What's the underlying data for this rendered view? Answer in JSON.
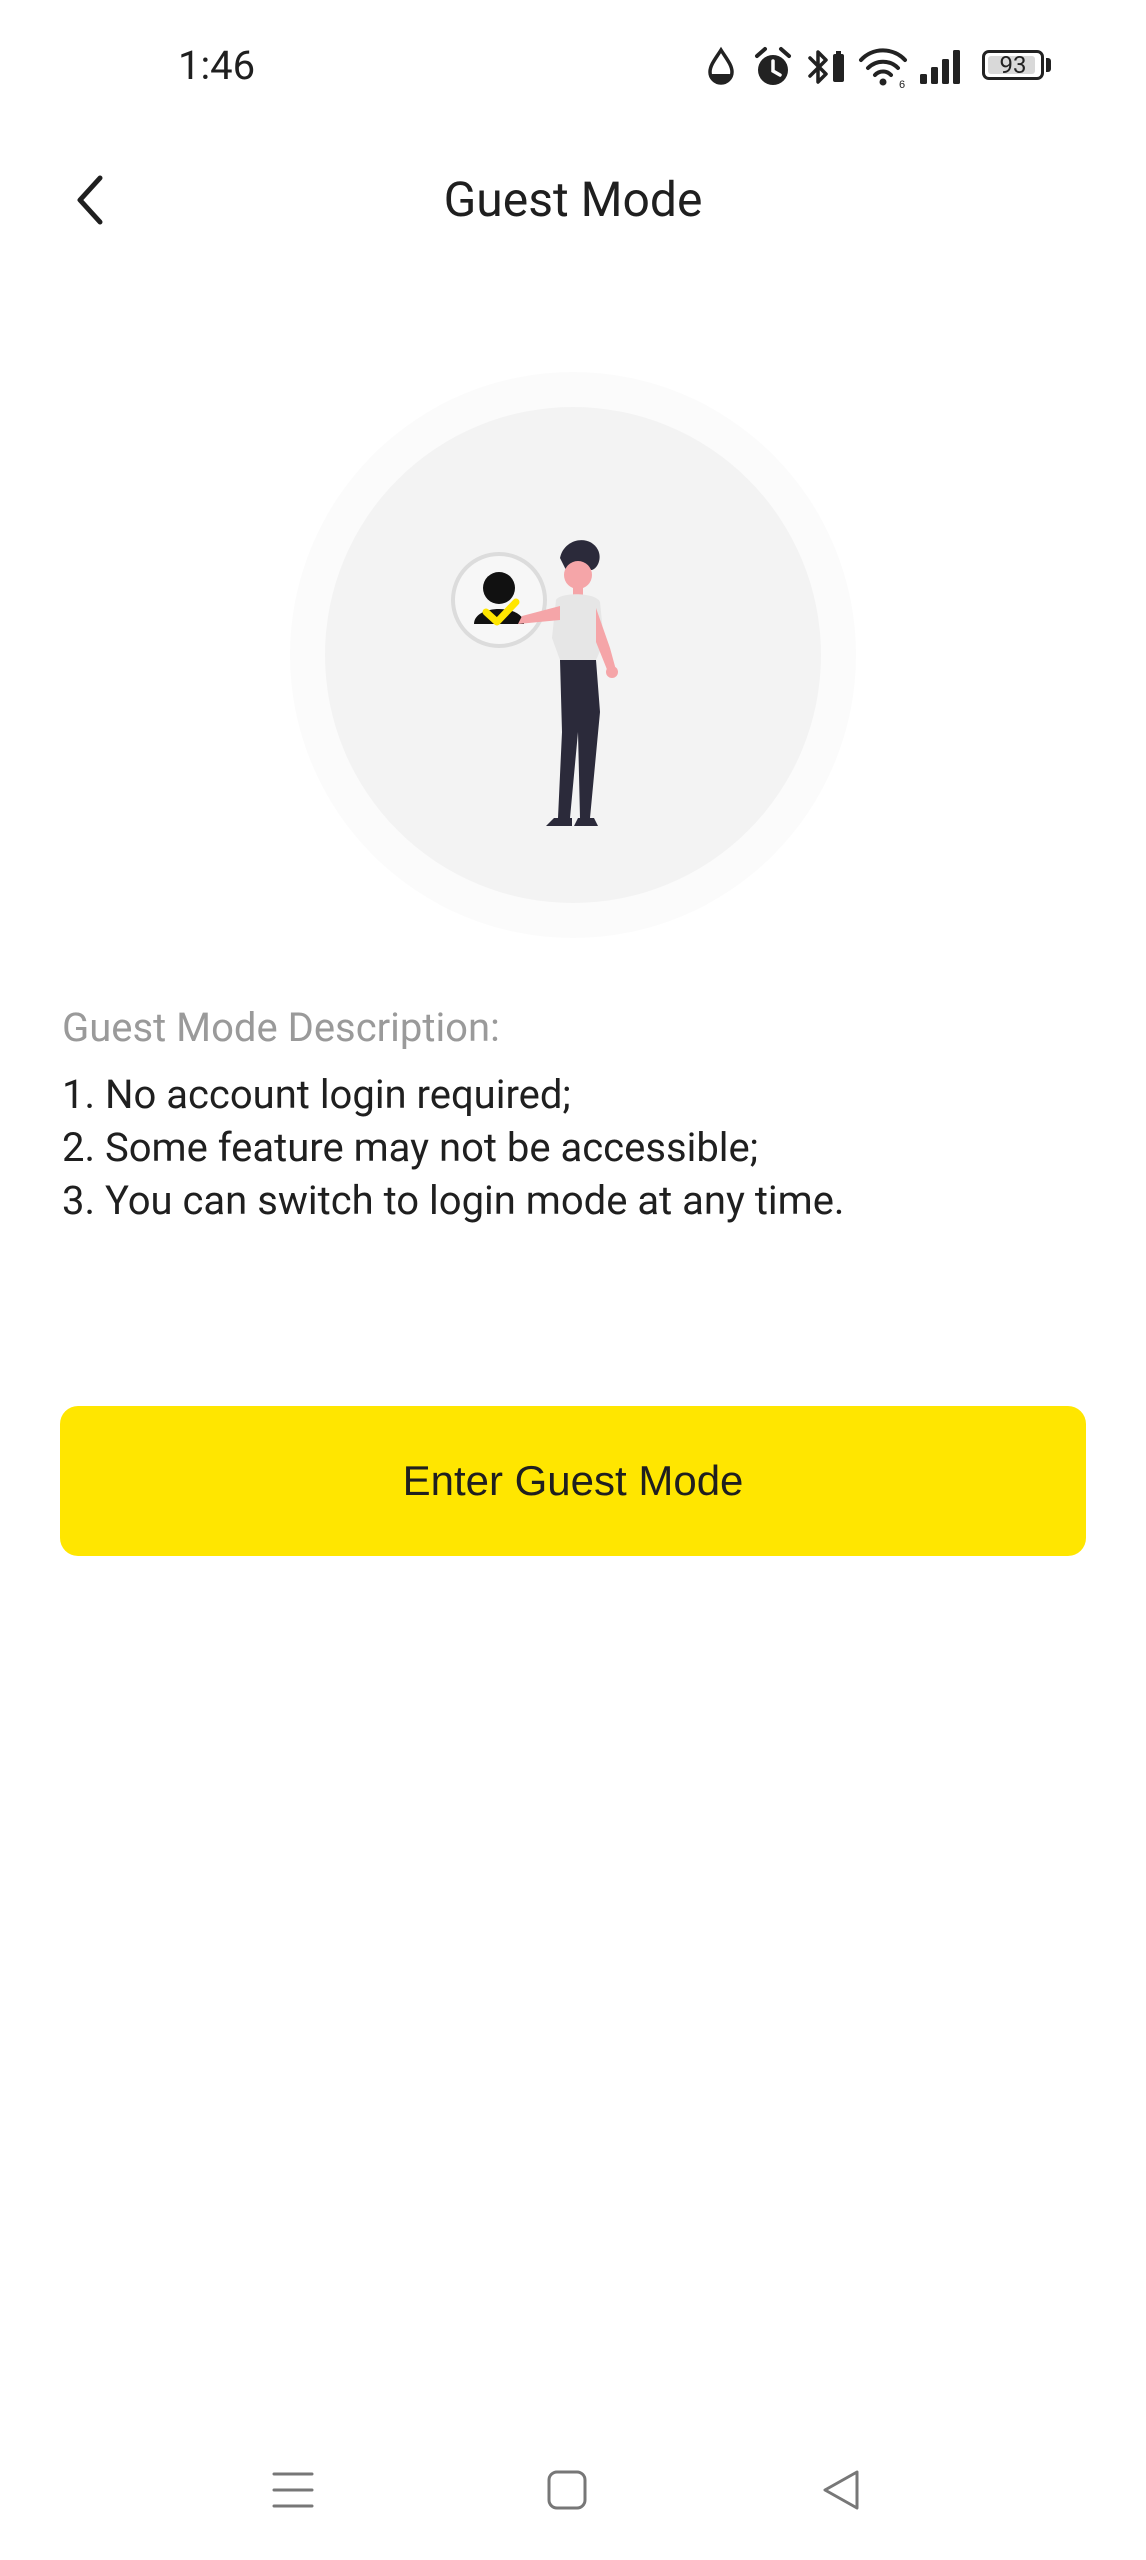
{
  "status_bar": {
    "time": "1:46",
    "battery_level": "93",
    "battery_fraction": 0.93,
    "icons": [
      "water-drop-icon",
      "alarm-icon",
      "bluetooth-icon",
      "wifi-icon",
      "cellular-signal-icon",
      "battery-icon"
    ]
  },
  "header": {
    "title": "Guest Mode",
    "back_icon": "chevron-left-icon"
  },
  "illustration": {
    "icon": "guest-user-illustration",
    "colors": {
      "circle_outer": "#fafafa",
      "circle_inner": "#f3f3f3",
      "accent": "#ffe600",
      "figure_pants": "#2b2a3a",
      "figure_skin": "#f5a5a8",
      "figure_shirt": "#e6e6e6"
    }
  },
  "description": {
    "heading": "Guest Mode Description:",
    "items": [
      "1. No account login required;",
      "2. Some feature may not be accessible;",
      "3. You can switch to login mode at any time."
    ]
  },
  "actions": {
    "enter_label": "Enter Guest Mode"
  },
  "nav_bar": {
    "icons": [
      "menu-icon",
      "home-icon",
      "back-triangle-icon"
    ]
  },
  "colors": {
    "accent": "#ffe600",
    "text_primary": "#1f1f1f",
    "text_secondary": "#9a9a9a",
    "background": "#ffffff"
  }
}
